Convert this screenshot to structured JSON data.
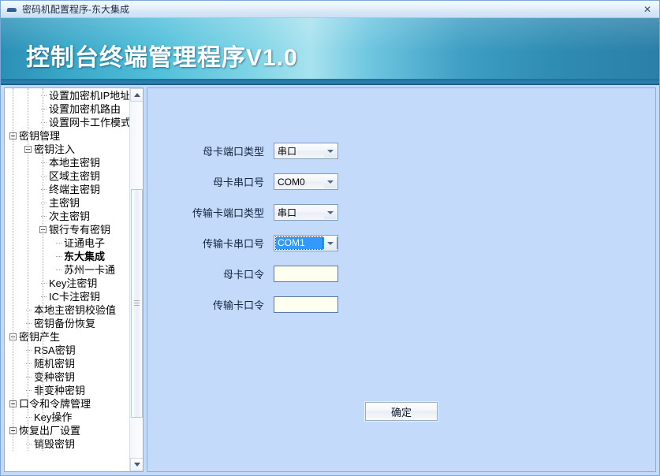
{
  "window": {
    "title": "密码机配置程序-东大集成",
    "icon": "application-icon",
    "close_label": "✕"
  },
  "banner": {
    "title": "控制台终端管理程序V1.0"
  },
  "tree": {
    "items": [
      {
        "label": "设置加密机IP地址",
        "depth": 2,
        "type": "leaf"
      },
      {
        "label": "设置加密机路由",
        "depth": 2,
        "type": "leaf"
      },
      {
        "label": "设置网卡工作模式",
        "depth": 2,
        "type": "leaf"
      },
      {
        "label": "密钥管理",
        "depth": 0,
        "type": "expanded"
      },
      {
        "label": "密钥注入",
        "depth": 1,
        "type": "expanded"
      },
      {
        "label": "本地主密钥",
        "depth": 2,
        "type": "leaf"
      },
      {
        "label": "区域主密钥",
        "depth": 2,
        "type": "leaf"
      },
      {
        "label": "终端主密钥",
        "depth": 2,
        "type": "leaf"
      },
      {
        "label": "主密钥",
        "depth": 2,
        "type": "leaf"
      },
      {
        "label": "次主密钥",
        "depth": 2,
        "type": "leaf"
      },
      {
        "label": "银行专有密钥",
        "depth": 2,
        "type": "expanded"
      },
      {
        "label": "证通电子",
        "depth": 3,
        "type": "leaf"
      },
      {
        "label": "东大集成",
        "depth": 3,
        "type": "leaf",
        "bold": true
      },
      {
        "label": "苏州一卡通",
        "depth": 3,
        "type": "leaf"
      },
      {
        "label": "Key注密钥",
        "depth": 2,
        "type": "leaf"
      },
      {
        "label": "IC卡注密钥",
        "depth": 2,
        "type": "leaf"
      },
      {
        "label": "本地主密钥校验值",
        "depth": 1,
        "type": "leaf"
      },
      {
        "label": "密钥备份恢复",
        "depth": 1,
        "type": "leaf"
      },
      {
        "label": "密钥产生",
        "depth": 0,
        "type": "expanded"
      },
      {
        "label": "RSA密钥",
        "depth": 1,
        "type": "leaf"
      },
      {
        "label": "随机密钥",
        "depth": 1,
        "type": "leaf"
      },
      {
        "label": "变种密钥",
        "depth": 1,
        "type": "leaf"
      },
      {
        "label": "非变种密钥",
        "depth": 1,
        "type": "leaf"
      },
      {
        "label": "口令和令牌管理",
        "depth": 0,
        "type": "expanded"
      },
      {
        "label": "Key操作",
        "depth": 1,
        "type": "leaf"
      },
      {
        "label": "恢复出厂设置",
        "depth": 0,
        "type": "expanded"
      },
      {
        "label": "销毁密钥",
        "depth": 1,
        "type": "leaf"
      }
    ]
  },
  "form": {
    "fields": [
      {
        "label": "母卡端口类型",
        "control": "combo",
        "value": "串口",
        "selected": false,
        "name": "mother-card-port-type"
      },
      {
        "label": "母卡串口号",
        "control": "combo",
        "value": "COM0",
        "selected": false,
        "name": "mother-card-com-port"
      },
      {
        "label": "传输卡端口类型",
        "control": "combo",
        "value": "串口",
        "selected": false,
        "name": "transfer-card-port-type"
      },
      {
        "label": "传输卡串口号",
        "control": "combo",
        "value": "COM1",
        "selected": true,
        "name": "transfer-card-com-port"
      },
      {
        "label": "母卡口令",
        "control": "text",
        "value": "",
        "placeholder": "",
        "name": "mother-card-password"
      },
      {
        "label": "传输卡口令",
        "control": "text",
        "value": "",
        "placeholder": "",
        "name": "transfer-card-password"
      }
    ],
    "submit_label": "确定"
  },
  "colors": {
    "panel_background": "#c3dafb",
    "banner_accent": "#3aa7c8",
    "selection_blue": "#3399ff",
    "input_background": "#fffff0"
  }
}
